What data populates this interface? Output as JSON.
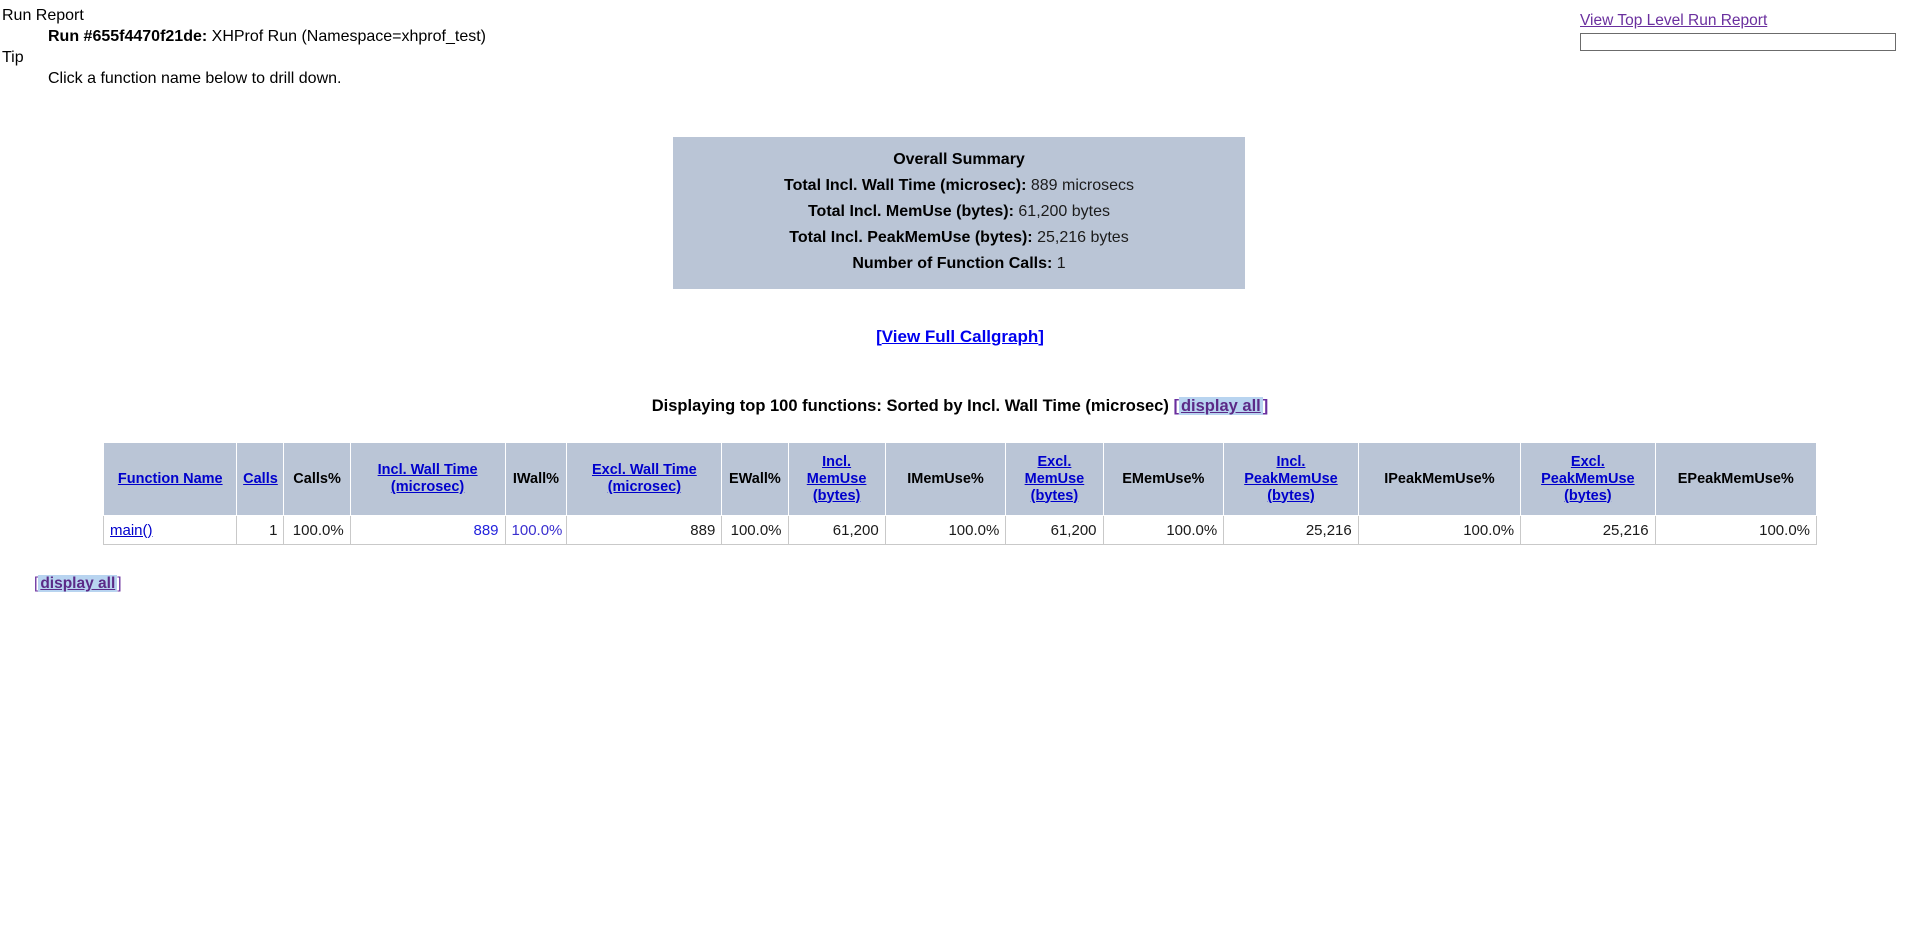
{
  "header": {
    "run_report_label": "Run Report",
    "run_id_prefix": "Run #655f4470f21de:",
    "run_description": "XHProf Run (Namespace=xhprof_test)",
    "tip_label": "Tip",
    "tip_text": "Click a function name below to drill down."
  },
  "top_right": {
    "link_label": "View Top Level Run Report",
    "input_value": "",
    "input_placeholder": ""
  },
  "summary": {
    "title": "Overall Summary",
    "rows": [
      {
        "key": "Total Incl. Wall Time (microsec):",
        "value": "889 microsecs"
      },
      {
        "key": "Total Incl. MemUse (bytes):",
        "value": "61,200 bytes"
      },
      {
        "key": "Total Incl. PeakMemUse (bytes):",
        "value": "25,216 bytes"
      },
      {
        "key": "Number of Function Calls:",
        "value": "1"
      }
    ]
  },
  "callgraph": {
    "open_bracket": "[",
    "label": "View Full Callgraph",
    "close_bracket": "]"
  },
  "displaying": {
    "text": "Displaying top 100 functions: Sorted by Incl. Wall Time (microsec)",
    "open_bracket": "[",
    "display_all_label": "display all",
    "close_bracket": "]"
  },
  "bottom_display": {
    "open_bracket": "[",
    "display_all_label": "display all",
    "close_bracket": "]"
  },
  "table": {
    "columns": [
      {
        "label": "Function Name",
        "linked": true,
        "align": "left"
      },
      {
        "label": "Calls",
        "linked": true,
        "align": "right"
      },
      {
        "label": "Calls%",
        "linked": false,
        "align": "right"
      },
      {
        "label": "Incl. Wall Time (microsec)",
        "linked": true,
        "align": "right"
      },
      {
        "label": "IWall%",
        "linked": false,
        "align": "right"
      },
      {
        "label": "Excl. Wall Time (microsec)",
        "linked": true,
        "align": "right"
      },
      {
        "label": "EWall%",
        "linked": false,
        "align": "right"
      },
      {
        "label": "Incl. MemUse (bytes)",
        "linked": true,
        "align": "right"
      },
      {
        "label": "IMemUse%",
        "linked": false,
        "align": "right"
      },
      {
        "label": "Excl. MemUse (bytes)",
        "linked": true,
        "align": "right"
      },
      {
        "label": "EMemUse%",
        "linked": false,
        "align": "right"
      },
      {
        "label": "Incl. PeakMemUse (bytes)",
        "linked": true,
        "align": "right"
      },
      {
        "label": "IPeakMemUse%",
        "linked": false,
        "align": "right"
      },
      {
        "label": "Excl. PeakMemUse (bytes)",
        "linked": true,
        "align": "right"
      },
      {
        "label": "EPeakMemUse%",
        "linked": false,
        "align": "right"
      }
    ],
    "rows": [
      {
        "function_name": "main()",
        "calls": "1",
        "calls_pct": "100.0%",
        "incl_wall_time": "889",
        "iwall_pct": "100.0%",
        "excl_wall_time": "889",
        "ewall_pct": "100.0%",
        "incl_memuse": "61,200",
        "imemuse_pct": "100.0%",
        "excl_memuse": "61,200",
        "ememuse_pct": "100.0%",
        "incl_peakmemuse": "25,216",
        "ipeakmemuse_pct": "100.0%",
        "excl_peakmemuse": "25,216",
        "epeakmemuse_pct": "100.0%"
      }
    ]
  },
  "colors": {
    "summary_bg": "#bac5d6",
    "table_header_bg": "#bac5d6",
    "link_blue": "#0000cc",
    "visited_purple": "#5b2a87",
    "selection_bg": "#b8d4f0"
  }
}
